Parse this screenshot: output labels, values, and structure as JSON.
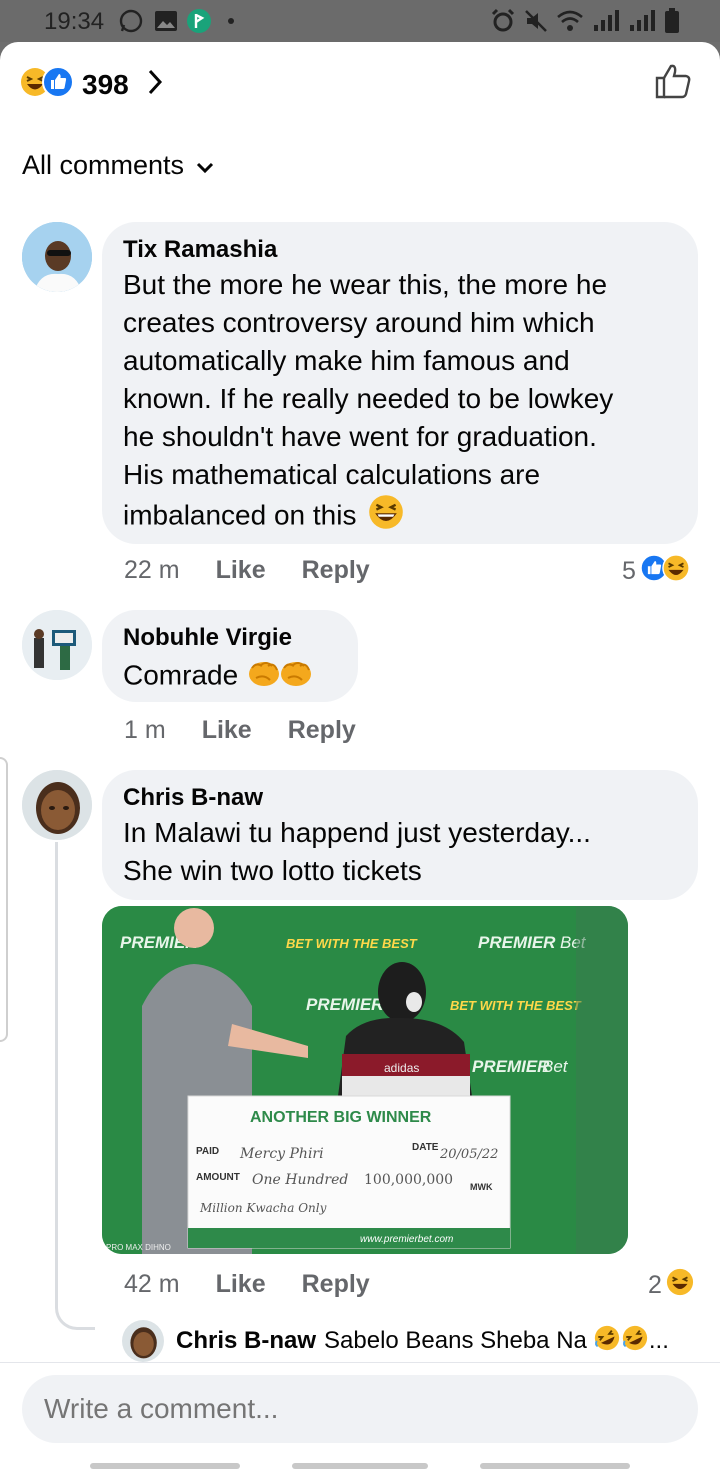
{
  "status_bar": {
    "time": "19:34"
  },
  "header": {
    "reaction_count": "398"
  },
  "filter": {
    "label": "All comments"
  },
  "comments": [
    {
      "author": "Tix Ramashia",
      "lines": [
        "But the more he wear this, the more he",
        "creates controversy around him which",
        "automatically make him famous and",
        "known. If he really needed to be lowkey",
        "he shouldn't have went for graduation.",
        "His mathematical calculations are",
        "imbalanced on this"
      ],
      "time": "22 m",
      "like": "Like",
      "reply": "Reply",
      "reactions": "5"
    },
    {
      "author": "Nobuhle Virgie",
      "lines": [
        "Comrade"
      ],
      "time": "1 m",
      "like": "Like",
      "reply": "Reply"
    },
    {
      "author": "Chris B-naw",
      "lines": [
        "In Malawi tu happend just yesterday...",
        "She win two lotto tickets"
      ],
      "time": "42 m",
      "like": "Like",
      "reply": "Reply",
      "reactions": "2",
      "photo": {
        "banner_tagline": "BET WITH THE BEST",
        "banner_brand_a": "PREMIER",
        "banner_brand_b": "Bet",
        "cheque_title": "ANOTHER BIG WINNER",
        "paid_label": "PAID",
        "paid_value": "Mercy Phiri",
        "date_label": "DATE",
        "date_value": "20/05/22",
        "amount_label": "AMOUNT",
        "amount_words": "One Hundred",
        "amount_value": "100,000,000",
        "currency": "MWK",
        "amount_words_2": "Million Kwacha Only",
        "website": "www.premierbet.com",
        "hoodie_text": "adidas",
        "watermark": "PRO MAX DIHNO"
      }
    }
  ],
  "reply_preview": {
    "author": "Chris B-naw",
    "text": "Sabelo Beans Sheba Na",
    "ellipsis": "..."
  },
  "composer": {
    "placeholder": "Write a comment..."
  },
  "colors": {
    "like_blue": "#1877f2",
    "haha_yellow": "#f7b928",
    "meta_gray": "#65676b",
    "bubble": "#f0f2f5",
    "banner_green": "#2a8a45"
  }
}
